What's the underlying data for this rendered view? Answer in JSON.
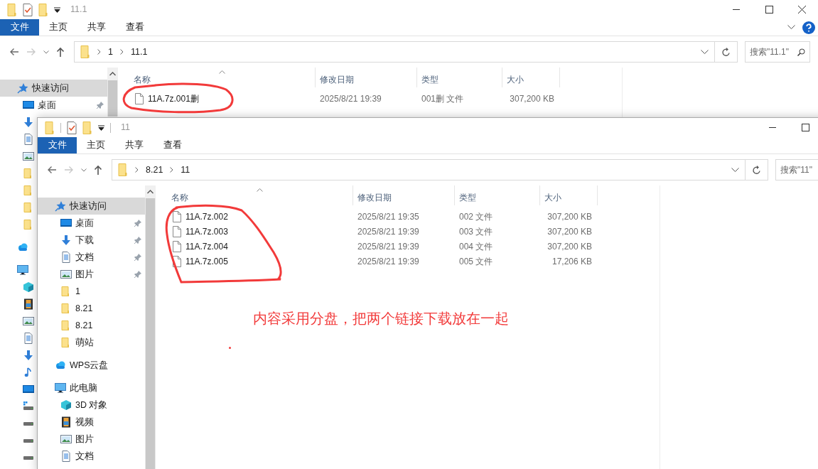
{
  "windows": [
    {
      "title": "11.1",
      "ribbon": [
        {
          "label": "文件",
          "kind": "menu"
        },
        {
          "label": "主页",
          "kind": "tab"
        },
        {
          "label": "共享",
          "kind": "tab"
        },
        {
          "label": "查看",
          "kind": "tab"
        }
      ],
      "nav": {
        "back": {
          "disabled": false
        },
        "forward": {
          "disabled": true
        }
      },
      "breadcrumb": [
        "1",
        "11.1"
      ],
      "search": {
        "placeholder": "搜索\"11.1\""
      },
      "columns": [
        "名称",
        "修改日期",
        "类型",
        "大小"
      ],
      "rows": [
        {
          "name": "11A.7z.001删",
          "modified": "2025/8/21 19:39",
          "type": "001删 文件",
          "size": "307,200 KB"
        }
      ],
      "sidebar": [
        {
          "label": "快速访问",
          "kind": "star",
          "selected": true,
          "children": [
            {
              "label": "桌面",
              "kind": "desktop",
              "pinned": true
            },
            {
              "kind": "download"
            },
            {
              "kind": "document"
            },
            {
              "kind": "picture"
            },
            {
              "kind": "folder"
            },
            {
              "kind": "folder"
            },
            {
              "kind": "folder"
            },
            {
              "kind": "folder"
            }
          ]
        },
        {
          "kind": "cloud",
          "selected": false
        },
        {
          "kind": "pc",
          "selected": false,
          "children": [
            {
              "kind": "cube"
            },
            {
              "kind": "video"
            },
            {
              "kind": "picture"
            },
            {
              "kind": "document"
            },
            {
              "kind": "download"
            },
            {
              "kind": "music"
            },
            {
              "kind": "desktop"
            },
            {
              "kind": "windrive"
            },
            {
              "kind": "drive"
            },
            {
              "kind": "drive"
            },
            {
              "kind": "drive"
            }
          ]
        }
      ]
    },
    {
      "title": "11",
      "ribbon": [
        {
          "label": "文件",
          "kind": "menu"
        },
        {
          "label": "主页",
          "kind": "tab"
        },
        {
          "label": "共享",
          "kind": "tab"
        },
        {
          "label": "查看",
          "kind": "tab"
        }
      ],
      "nav": {
        "back": {
          "disabled": false
        },
        "forward": {
          "disabled": true
        }
      },
      "breadcrumb": [
        "8.21",
        "11"
      ],
      "search": {
        "placeholder": "搜索\"11\""
      },
      "columns": [
        "名称",
        "修改日期",
        "类型",
        "大小"
      ],
      "rows": [
        {
          "name": "11A.7z.002",
          "modified": "2025/8/21 19:35",
          "type": "002 文件",
          "size": "307,200 KB"
        },
        {
          "name": "11A.7z.003",
          "modified": "2025/8/21 19:39",
          "type": "003 文件",
          "size": "307,200 KB"
        },
        {
          "name": "11A.7z.004",
          "modified": "2025/8/21 19:39",
          "type": "004 文件",
          "size": "307,200 KB"
        },
        {
          "name": "11A.7z.005",
          "modified": "2025/8/21 19:39",
          "type": "005 文件",
          "size": "17,206 KB"
        }
      ],
      "sidebar": [
        {
          "label": "快速访问",
          "kind": "star",
          "selected": true,
          "children": [
            {
              "label": "桌面",
              "kind": "desktop",
              "pinned": true
            },
            {
              "label": "下载",
              "kind": "download",
              "pinned": true
            },
            {
              "label": "文档",
              "kind": "document",
              "pinned": true
            },
            {
              "label": "图片",
              "kind": "picture",
              "pinned": true
            },
            {
              "label": "1",
              "kind": "folder",
              "pinned": false
            },
            {
              "label": "8.21",
              "kind": "folder",
              "pinned": false
            },
            {
              "label": "8.21",
              "kind": "folder",
              "pinned": false
            },
            {
              "label": "萌站",
              "kind": "folder",
              "pinned": false
            }
          ]
        },
        {
          "label": "WPS云盘",
          "kind": "cloud",
          "selected": false
        },
        {
          "label": "此电脑",
          "kind": "pc",
          "selected": false,
          "children": [
            {
              "label": "3D 对象",
              "kind": "cube"
            },
            {
              "label": "视频",
              "kind": "video"
            },
            {
              "label": "图片",
              "kind": "picture"
            },
            {
              "label": "文档",
              "kind": "document"
            }
          ]
        }
      ]
    }
  ],
  "note": "内容采用分盘，把两个链接下载放在一起"
}
